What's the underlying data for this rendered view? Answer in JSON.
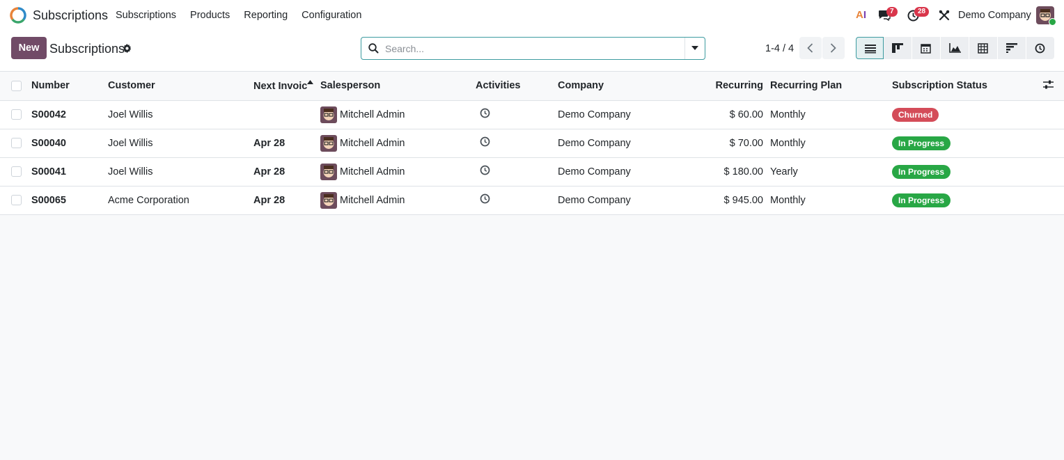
{
  "navbar": {
    "app_name": "Subscriptions",
    "menu": [
      "Subscriptions",
      "Products",
      "Reporting",
      "Configuration"
    ],
    "ai_label": {
      "a": "A",
      "i": "I"
    },
    "chat_count": "7",
    "activity_count": "28",
    "company": "Demo Company"
  },
  "control": {
    "new_label": "New",
    "title": "Subscriptions",
    "search_placeholder": "Search...",
    "pager": "1-4 / 4"
  },
  "table": {
    "columns": [
      "Number",
      "Customer",
      "Next Invoic",
      "Salesperson",
      "Activities",
      "Company",
      "Recurring",
      "Recurring Plan",
      "Subscription Status"
    ],
    "rows": [
      {
        "number": "S00042",
        "customer": "Joel Willis",
        "next_invoice": "",
        "salesperson": "Mitchell Admin",
        "company": "Demo Company",
        "recurring": "$ 60.00",
        "plan": "Monthly",
        "status": "Churned"
      },
      {
        "number": "S00040",
        "customer": "Joel Willis",
        "next_invoice": "Apr 28",
        "salesperson": "Mitchell Admin",
        "company": "Demo Company",
        "recurring": "$ 70.00",
        "plan": "Monthly",
        "status": "In Progress"
      },
      {
        "number": "S00041",
        "customer": "Joel Willis",
        "next_invoice": "Apr 28",
        "salesperson": "Mitchell Admin",
        "company": "Demo Company",
        "recurring": "$ 180.00",
        "plan": "Yearly",
        "status": "In Progress"
      },
      {
        "number": "S00065",
        "customer": "Acme Corporation",
        "next_invoice": "Apr 28",
        "salesperson": "Mitchell Admin",
        "company": "Demo Company",
        "recurring": "$ 945.00",
        "plan": "Monthly",
        "status": "In Progress"
      }
    ]
  },
  "colors": {
    "brand": "#714b67",
    "accent": "#3d9ba0",
    "churned": "#d44c59",
    "in_progress": "#28a745"
  }
}
